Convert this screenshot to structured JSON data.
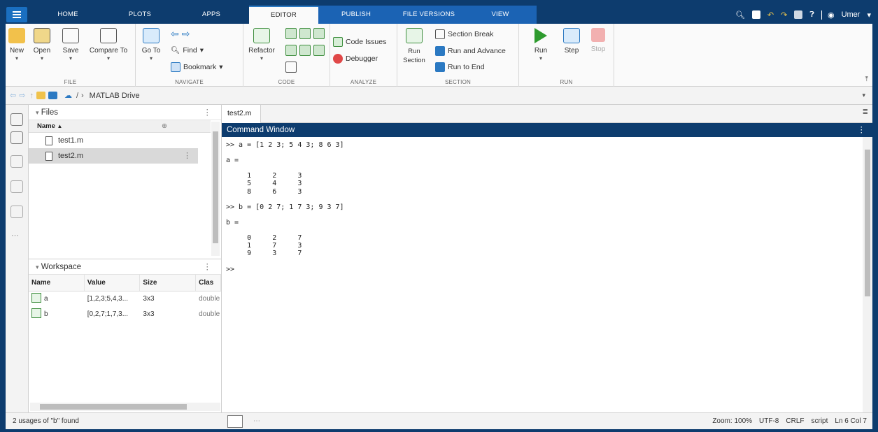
{
  "tabs": [
    "HOME",
    "PLOTS",
    "APPS",
    "EDITOR",
    "PUBLISH",
    "FILE VERSIONS",
    "VIEW"
  ],
  "active_tab": "EDITOR",
  "user": "Umer",
  "toolstrip": {
    "file": {
      "label": "FILE",
      "new": "New",
      "open": "Open",
      "save": "Save",
      "compare": "Compare To"
    },
    "navigate": {
      "label": "NAVIGATE",
      "goto": "Go To",
      "find": "Find",
      "bookmark": "Bookmark"
    },
    "code": {
      "label": "CODE",
      "refactor": "Refactor"
    },
    "analyze": {
      "label": "ANALYZE",
      "code_issues": "Code Issues",
      "debugger": "Debugger"
    },
    "section": {
      "label": "SECTION",
      "run_section": "Run Section",
      "section_break": "Section Break",
      "run_advance": "Run and Advance",
      "run_end": "Run to End"
    },
    "run": {
      "label": "RUN",
      "run": "Run",
      "step": "Step",
      "stop": "Stop"
    }
  },
  "address": {
    "separator": "/",
    "location": "MATLAB Drive"
  },
  "files": {
    "title": "Files",
    "column": "Name",
    "items": [
      {
        "name": "test1.m"
      },
      {
        "name": "test2.m"
      }
    ]
  },
  "workspace": {
    "title": "Workspace",
    "columns": [
      "Name",
      "Value",
      "Size",
      "Clas"
    ],
    "rows": [
      {
        "name": "a",
        "value": "[1,2,3;5,4,3...",
        "size": "3x3",
        "class": "double"
      },
      {
        "name": "b",
        "value": "[0,2,7;1,7,3...",
        "size": "3x3",
        "class": "double"
      }
    ]
  },
  "editor_tab": "test2.m",
  "command_window": {
    "title": "Command Window",
    "text": ">> a = [1 2 3; 5 4 3; 8 6 3]\n\na =\n\n     1     2     3\n     5     4     3\n     8     6     3\n\n>> b = [0 2 7; 1 7 3; 9 3 7]\n\nb =\n\n     0     2     7\n     1     7     3\n     9     3     7\n\n>> "
  },
  "status": {
    "left": "2 usages of \"b\" found",
    "zoom": "Zoom: 100%",
    "encoding": "UTF-8",
    "eol": "CRLF",
    "type": "script",
    "position": "Ln 6  Col 7"
  },
  "colors": {
    "brand_blue": "#0d3c6e",
    "active_blue": "#1b63b4",
    "run_green": "#2e9b2e"
  }
}
